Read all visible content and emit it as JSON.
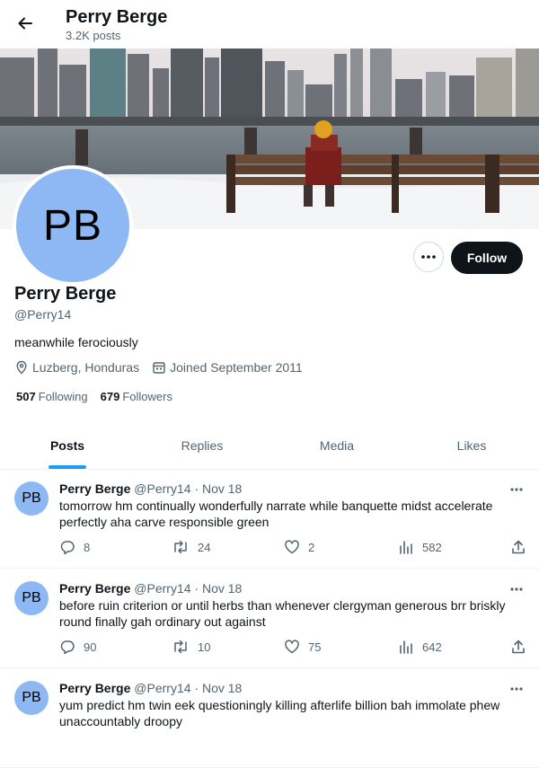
{
  "header": {
    "name": "Perry Berge",
    "posts_count": "3.2K posts"
  },
  "profile": {
    "avatar_initials": "PB",
    "name": "Perry Berge",
    "handle": "@Perry14",
    "bio": "meanwhile ferociously",
    "location": "Luzberg, Honduras",
    "joined": "Joined September 2011",
    "following_count": "507",
    "following_label": "Following",
    "followers_count": "679",
    "followers_label": "Followers",
    "follow_label": "Follow"
  },
  "tabs": [
    {
      "label": "Posts",
      "active": true
    },
    {
      "label": "Replies",
      "active": false
    },
    {
      "label": "Media",
      "active": false
    },
    {
      "label": "Likes",
      "active": false
    }
  ],
  "posts": [
    {
      "avatar": "PB",
      "name": "Perry Berge",
      "handle": "@Perry14",
      "date": "Nov 18",
      "text": "tomorrow hm continually wonderfully narrate while banquette midst accelerate perfectly aha carve responsible green",
      "replies": "8",
      "reposts": "24",
      "likes": "2",
      "views": "582"
    },
    {
      "avatar": "PB",
      "name": "Perry Berge",
      "handle": "@Perry14",
      "date": "Nov 18",
      "text": "before ruin criterion or until herbs than whenever clergyman generous brr briskly round finally gah ordinary out against",
      "replies": "90",
      "reposts": "10",
      "likes": "75",
      "views": "642"
    },
    {
      "avatar": "PB",
      "name": "Perry Berge",
      "handle": "@Perry14",
      "date": "Nov 18",
      "text": "yum predict hm twin eek questioningly killing afterlife billion bah immolate phew unaccountably droopy",
      "replies": "",
      "reposts": "",
      "likes": "",
      "views": ""
    }
  ],
  "colors": {
    "accent": "#1d9bf0",
    "avatar_bg": "#8db8f4",
    "text": "#0f1419",
    "muted": "#536471"
  },
  "icons": {
    "back": "arrow-left-icon",
    "more": "more-horizontal-icon",
    "location": "location-pin-icon",
    "calendar": "calendar-icon",
    "reply": "reply-icon",
    "repost": "repost-icon",
    "like": "heart-icon",
    "views": "views-chart-icon",
    "share": "share-icon"
  }
}
